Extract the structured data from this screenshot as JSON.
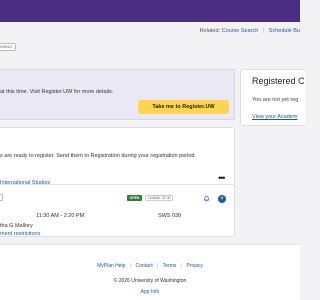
{
  "header": {
    "related_label": "Related:",
    "links": [
      "Course Search",
      "Schedule Bu"
    ]
  },
  "status_pill": "DMING",
  "notice": {
    "text": "at this time. Visit Register.UW for more details.",
    "button_label": "Take me to Register.UW"
  },
  "cart": {
    "message": "s are ready to register. Send them to Registration during your registration period.",
    "more_label": "•••",
    "course": {
      "title": "International Studies",
      "status": "OPEN",
      "seats": "15 AVAIL OF 30",
      "time": "11:30 AM - 2:20 PM",
      "room": "SWS 030",
      "instructor": "tha G Mallory",
      "restrictions_link": "ment restrictions",
      "remove_symbol": "×"
    }
  },
  "side_panel": {
    "title": "Registered C",
    "text": "You are not yet reg",
    "link": "View your Academ"
  },
  "footer": {
    "links": [
      "MyPlan Help",
      "Contact",
      "Terms",
      "Privacy"
    ],
    "copyright": "© 2026 University of Washington",
    "app_info": "App Info"
  },
  "colors": {
    "brand_purple": "#4b2e83",
    "link_blue": "#1d5aa3",
    "button_yellow": "#ffd54f",
    "open_green": "#2e7d32",
    "notice_bg": "#ebe8f6"
  }
}
